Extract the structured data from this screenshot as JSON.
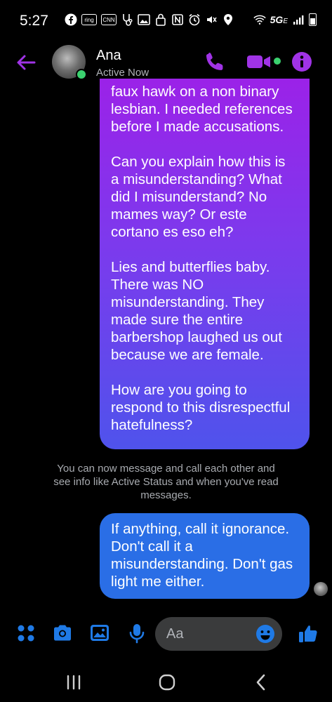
{
  "status_bar": {
    "time": "5:27",
    "notification_icons": [
      "facebook-icon",
      "ring-icon",
      "cnn-icon",
      "stethoscope-icon",
      "image-icon",
      "lock-icon",
      "nfc-icon",
      "alarm-icon",
      "mute-icon",
      "location-icon"
    ],
    "ring_label": "ring",
    "cnn_label": "CNN",
    "network": "5G",
    "network_sub": "E"
  },
  "header": {
    "contact_name": "Ana",
    "contact_status": "Active Now"
  },
  "messages": {
    "purple_bubble": "faux hawk on a non binary\nlesbian. I needed references\nbefore I made accusations.\n\nCan you explain how this is\na misunderstanding? What\ndid I misunderstand? No\nmames way? Or este\ncortano es eso eh?\n\nLies and butterflies baby.\nThere was NO\nmisunderstanding. They\nmade sure the entire\nbarbershop laughed us out\nbecause we are female.\n\nHow are you going to\nrespond to this disrespectful\nhatefulness?",
    "system_notice": "You can now message and call each other and see info like Active Status and when you've read messages.",
    "blue_bubble": "If anything, call it ignorance.\nDon't call it a\nmisunderstanding. Don't gas\nlight me either."
  },
  "composer": {
    "placeholder": "Aa"
  },
  "colors": {
    "accent_purple": "#a033e6",
    "accent_blue": "#1f7ae6",
    "online_green": "#3bd16f",
    "bubble_blue": "#2a6ee6"
  }
}
